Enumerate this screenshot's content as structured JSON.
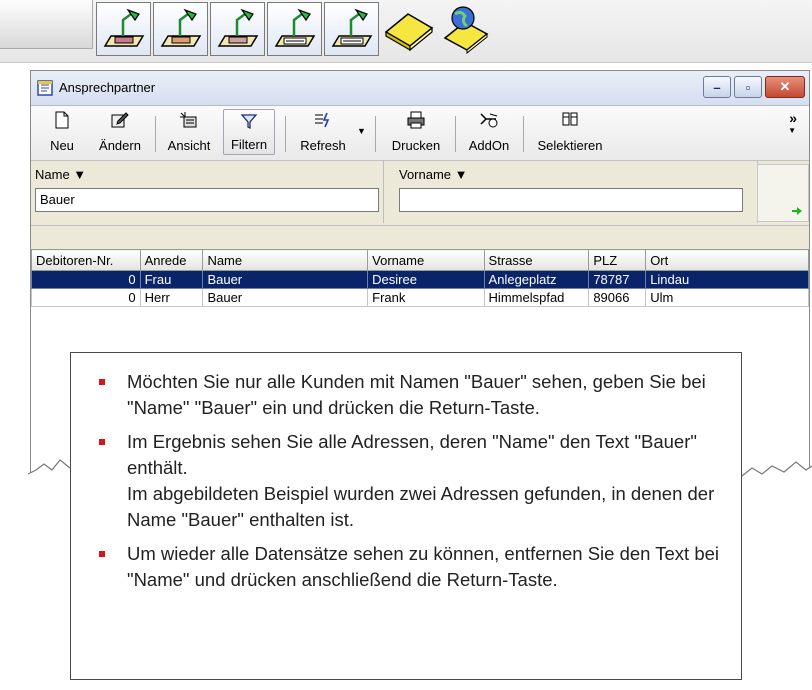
{
  "window": {
    "title": "Ansprechpartner"
  },
  "toolbar": {
    "neu": "Neu",
    "aendern": "Ändern",
    "ansicht": "Ansicht",
    "filtern": "Filtern",
    "refresh": "Refresh",
    "drucken": "Drucken",
    "addon": "AddOn",
    "selektieren": "Selektieren",
    "more": "»"
  },
  "filter": {
    "name_label": "Name ▼",
    "name_value": "Bauer",
    "vorname_label": "Vorname ▼",
    "vorname_value": ""
  },
  "table": {
    "headers": [
      "Debitoren-Nr.",
      "Anrede",
      "Name",
      "Vorname",
      "Strasse",
      "PLZ",
      "Ort"
    ],
    "rows": [
      [
        "0",
        "Frau",
        "Bauer",
        "Desiree",
        "Anlegeplatz",
        "78787",
        "Lindau"
      ],
      [
        "0",
        "Herr",
        "Bauer",
        "Frank",
        "Himmelspfad",
        "89066",
        "Ulm"
      ]
    ]
  },
  "note": {
    "b1": "Möchten Sie nur alle Kunden mit Namen \"Bauer\" sehen, geben Sie bei \"Name\" \"Bauer\" ein und drücken die Return-Taste.",
    "b2a": "Im Ergebnis sehen Sie alle Adressen, deren \"Name\" den Text \"Bauer\" enthält.",
    "b2b": "Im abgebildeten Beispiel wurden zwei Adressen gefunden, in denen der Name \"Bauer\" enthalten ist.",
    "b3": "Um wieder alle Datensätze sehen zu können, entfernen Sie den Text bei \"Name\" und drücken anschließend die Return-Taste."
  },
  "icons": {
    "launchbar": [
      "lamp-document-icon",
      "lamp-document-icon",
      "lamp-document-icon",
      "lamp-form-icon",
      "lamp-form-icon",
      "yellow-book-icon",
      "globe-book-icon"
    ],
    "toolbar": [
      "new-document-icon",
      "edit-icon",
      "view-icon",
      "filter-icon",
      "refresh-icon",
      "printer-icon",
      "addon-icon",
      "select-columns-icon"
    ]
  },
  "colors": {
    "selection": "#0a246a",
    "bullet": "#e0101a",
    "close_button": "#c24a31"
  }
}
